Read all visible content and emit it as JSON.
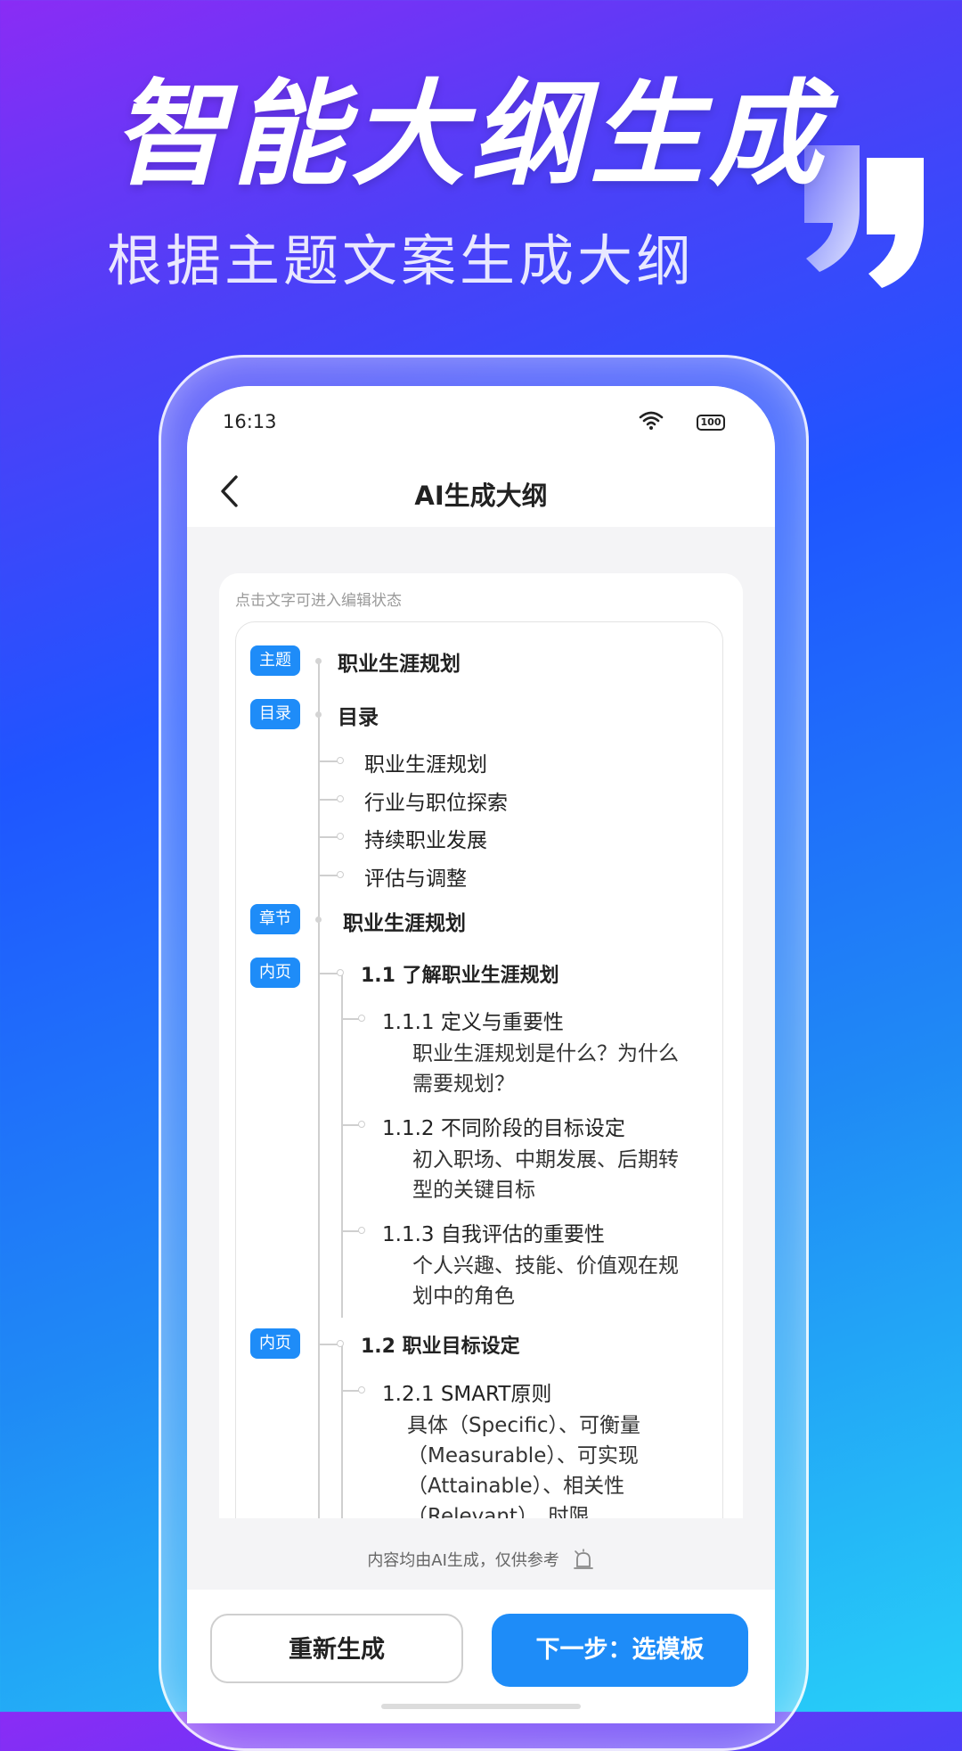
{
  "hero": {
    "title": "智能大纲生成",
    "subtitle": "根据主题文案生成大纲"
  },
  "status_bar": {
    "time": "16:13",
    "battery": "100"
  },
  "nav": {
    "title": "AI生成大纲"
  },
  "card": {
    "hint": "点击文字可进入编辑状态"
  },
  "outline": {
    "topic": {
      "tag": "主题",
      "text": "职业生涯规划"
    },
    "toc": {
      "tag": "目录",
      "text": "目录",
      "items": [
        "职业生涯规划",
        "行业与职位探索",
        "持续职业发展",
        "评估与调整"
      ]
    },
    "chapter": {
      "tag": "章节",
      "text": "职业生涯规划"
    },
    "pages": [
      {
        "tag": "内页",
        "title": "1.1 了解职业生涯规划",
        "subs": [
          {
            "title": "1.1.1 定义与重要性",
            "desc": "职业生涯规划是什么？为什么需要规划？"
          },
          {
            "title": "1.1.2 不同阶段的目标设定",
            "desc": "初入职场、中期发展、后期转型的关键目标"
          },
          {
            "title": "1.1.3 自我评估的重要性",
            "desc": "个人兴趣、技能、价值观在规划中的角色"
          }
        ]
      },
      {
        "tag": "内页",
        "title": "1.2 职业目标设定",
        "subs": [
          {
            "title": "1.2.1 SMART原则",
            "desc": "具体（Specific）、可衡量（Measurable）、可实现（Attainable）、相关性（Relevant）、时限"
          }
        ]
      }
    ]
  },
  "footer": {
    "note": "内容均由AI生成，仅供参考"
  },
  "buttons": {
    "regenerate": "重新生成",
    "next": "下一步：选模板"
  },
  "colors": {
    "accent": "#1e8cf8",
    "text": "#222222",
    "line": "#cfcfcf"
  }
}
